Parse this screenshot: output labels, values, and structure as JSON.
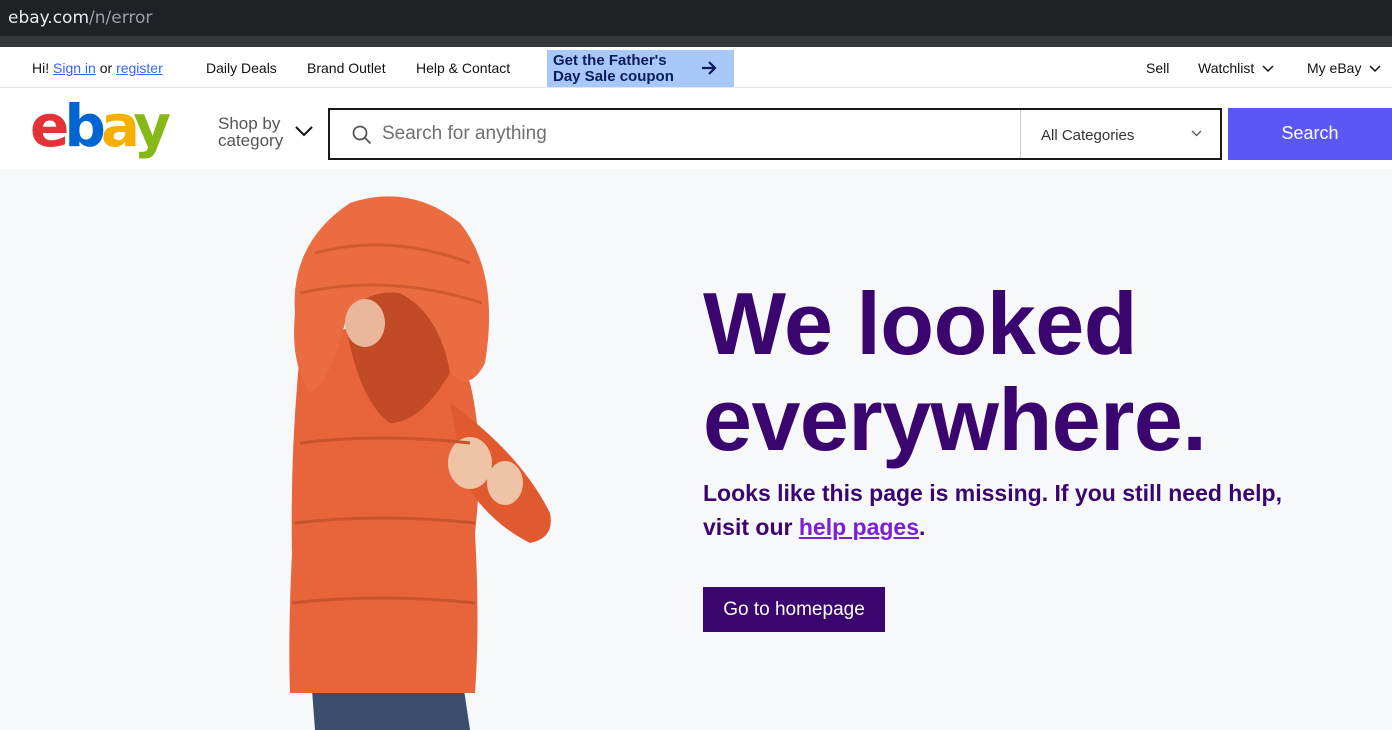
{
  "browser": {
    "url_host": "ebay.com",
    "url_path": "/n/error"
  },
  "topnav": {
    "greeting_prefix": "Hi!",
    "sign_in": "Sign in",
    "or": "or",
    "register": "register",
    "daily_deals": "Daily Deals",
    "brand_outlet": "Brand Outlet",
    "help_contact": "Help & Contact",
    "promo": "Get the Father's Day Sale coupon",
    "sell": "Sell",
    "watchlist": "Watchlist",
    "my_ebay": "My eBay"
  },
  "header": {
    "shop_by_1": "Shop by",
    "shop_by_2": "category",
    "search_placeholder": "Search for anything",
    "category_selected": "All Categories",
    "search_button": "Search"
  },
  "hero": {
    "headline_1": "We looked",
    "headline_2": "everywhere.",
    "sub_1": "Looks like this page is missing. If you still need help,",
    "sub_2_prefix": "visit our",
    "sub_link": "help pages",
    "sub_suffix": ".",
    "cta": "Go to homepage"
  },
  "colors": {
    "brand_purple": "#3b0570",
    "search_button": "#5a57f5",
    "link_blue": "#3665f3",
    "promo_bg": "#a7c8f8"
  },
  "icons": [
    "search-icon",
    "chevron-down-icon",
    "arrow-right-icon",
    "ebay-logo"
  ]
}
